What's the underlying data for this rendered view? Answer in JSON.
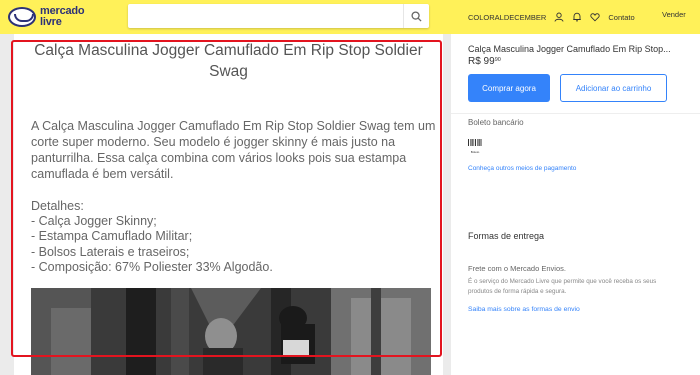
{
  "header": {
    "logo_line1": "mercado",
    "logo_line2": "livre",
    "search": {
      "value": "",
      "placeholder": ""
    },
    "username": "COLORALDECEMBER",
    "contact": "Contato",
    "sell": "Vender"
  },
  "description": {
    "title": "Calça Masculina Jogger Camuflado Em Rip Stop Soldier Swag",
    "paragraph": "A Calça Masculina Jogger Camuflado Em Rip Stop Soldier Swag tem um corte super moderno. Seu modelo é jogger skinny é mais justo na panturrilha. Essa calça combina com vários looks pois sua estampa camuflada é bem versátil.",
    "details_title": "Detalhes:",
    "details": [
      "- Calça Jogger Skinny;",
      "- Estampa Camuflado Militar;",
      "- Bolsos Laterais e traseiros;",
      "- Composição: 67% Poliester 33% Algodão."
    ]
  },
  "buy_box": {
    "title": "Calça Masculina Jogger Camuflado Em Rip Stop...",
    "price_main": "R$ 99",
    "price_cents": "90",
    "buy_now": "Comprar agora",
    "add_to_cart": "Adicionar ao carrinho"
  },
  "payment": {
    "method": "Boleto bancário",
    "barcode_caption": "Boleto",
    "more_link": "Conheça outros meios de pagamento"
  },
  "shipping": {
    "title": "Formas de entrega",
    "method": "Frete com o Mercado Envios.",
    "description": "É o serviço do Mercado Livre que permite que você receba os seus produtos de forma rápida e segura.",
    "more_link": "Saiba mais sobre as formas de envio"
  },
  "colors": {
    "header_bg": "#fff159",
    "brand_blue": "#2d3277",
    "accent_blue": "#3483fa",
    "highlight_red": "#e3141f"
  }
}
